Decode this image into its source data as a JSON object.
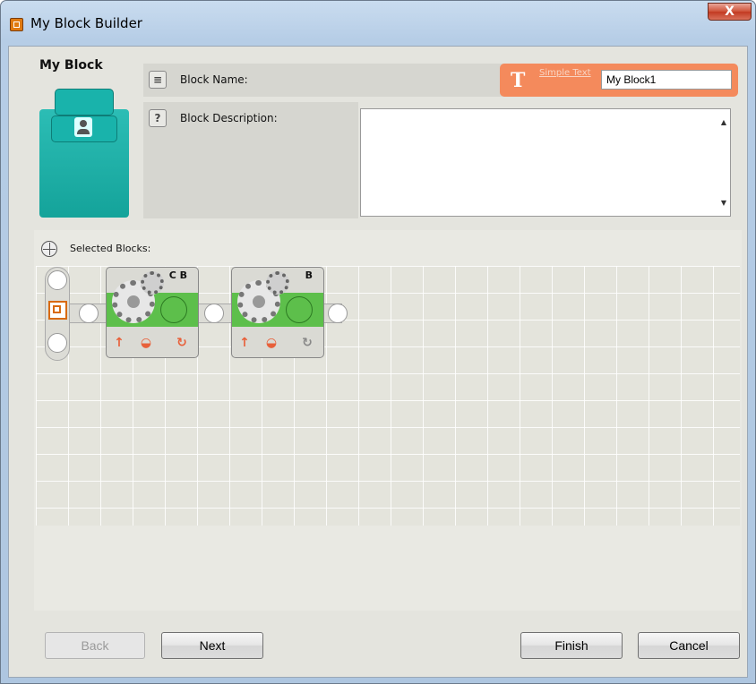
{
  "window": {
    "title": "My Block Builder",
    "close_glyph": "X"
  },
  "block": {
    "title": "My Block",
    "name_label": "Block Name:",
    "description_label": "Block Description:",
    "name_mode": "Simple Text",
    "name_value": "My Block1",
    "description_value": ""
  },
  "selected": {
    "label": "Selected Blocks:",
    "blocks": [
      {
        "type": "motor",
        "ports": "C B"
      },
      {
        "type": "motor",
        "ports": "B"
      }
    ]
  },
  "footer": {
    "back": "Back",
    "next": "Next",
    "finish": "Finish",
    "cancel": "Cancel"
  },
  "colors": {
    "accent_orange": "#f48a5c",
    "block_teal": "#1aaea5",
    "motor_green": "#5dbf4b"
  }
}
